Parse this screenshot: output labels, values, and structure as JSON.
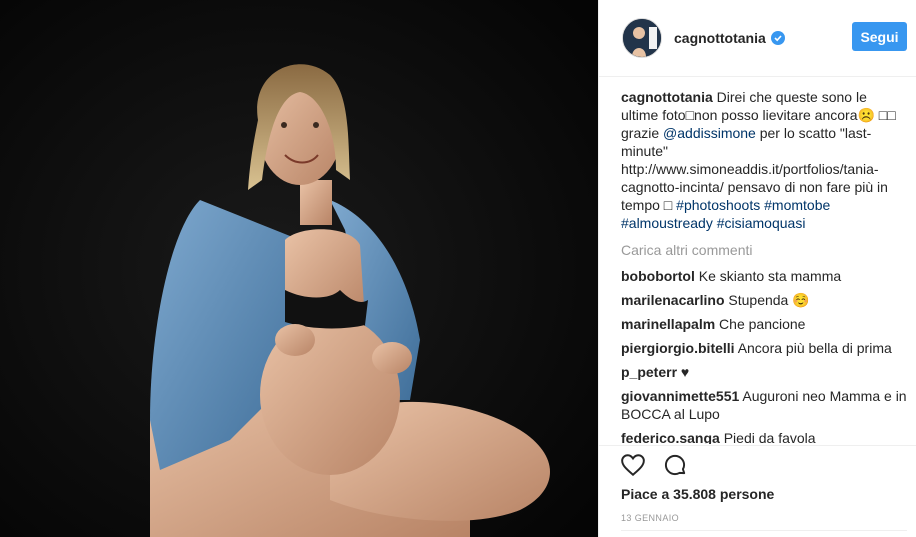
{
  "photo": {
    "alt": "",
    "background": "#0a0a0a"
  },
  "header": {
    "username": "cagnottotania",
    "verified_icon": "verified-badge-icon",
    "follow_label": "Segui"
  },
  "caption": {
    "username": "cagnottotania",
    "text_1": " Direi che queste sono le ultime foto□non posso lievitare ancora☹️ □□ grazie ",
    "mention": "@addissimone",
    "text_2": " per lo scatto \"last-minute\" http://www.simoneaddis.it/portfolios/tania-cagnotto-incinta/ pensavo di non fare più in tempo □ ",
    "hashtags": [
      "#photoshoots",
      "#momtobe",
      "#almoustready",
      "#cisiamoquasi"
    ]
  },
  "load_more": "Carica altri commenti",
  "comments": [
    {
      "user": "bobobortol",
      "text": "Ke skianto sta mamma"
    },
    {
      "user": "marilenacarlino",
      "text": "Stupenda ☺️"
    },
    {
      "user": "marinellapalm",
      "text": "Che pancione"
    },
    {
      "user": "piergiorgio.bitelli",
      "text": "Ancora più bella di prima"
    },
    {
      "user": "p_peterr",
      "text": "♥"
    },
    {
      "user": "giovannimette551",
      "text": "Auguroni neo Mamma e in BOCCA al Lupo"
    },
    {
      "user": "federico.sanga",
      "text": "Piedi da favola"
    }
  ],
  "actions": {
    "like_icon": "heart-icon",
    "comment_icon": "comment-bubble-icon"
  },
  "likes": "Piace a 35.808 persone",
  "date": "13 GENNAIO",
  "colors": {
    "follow_button": "#3897f0",
    "link": "#003569",
    "muted": "#999999"
  }
}
